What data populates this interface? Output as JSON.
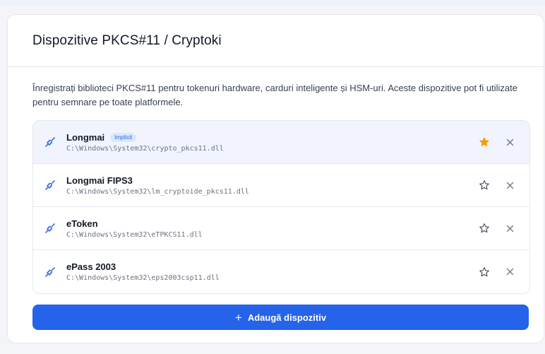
{
  "card": {
    "title": "Dispozitive PKCS#11 / Cryptoki",
    "description": "Înregistrați biblioteci PKCS#11 pentru tokenuri hardware, carduri inteligente și HSM-uri. Aceste dispozitive pot fi utilizate pentru semnare pe toate platformele."
  },
  "devices": [
    {
      "name": "Longmai",
      "badge": "Implicit",
      "path": "C:\\Windows\\System32\\crypto_pkcs11.dll",
      "default": true
    },
    {
      "name": "Longmai FIPS3",
      "badge": "",
      "path": "C:\\Windows\\System32\\lm_cryptoide_pkcs11.dll",
      "default": false
    },
    {
      "name": "eToken",
      "badge": "",
      "path": "C:\\Windows\\System32\\eTPKCS11.dll",
      "default": false
    },
    {
      "name": "ePass 2003",
      "badge": "",
      "path": "C:\\Windows\\System32\\eps2003csp11.dll",
      "default": false
    }
  ],
  "add_button": {
    "icon": "+",
    "label": "Adaugă dispozitiv"
  },
  "colors": {
    "accent": "#2563eb",
    "star_active": "#f59e0b",
    "icon": "#3b6fe0"
  },
  "icons": {
    "device": "plug-icon",
    "default": "star-icon",
    "remove": "close-icon"
  }
}
